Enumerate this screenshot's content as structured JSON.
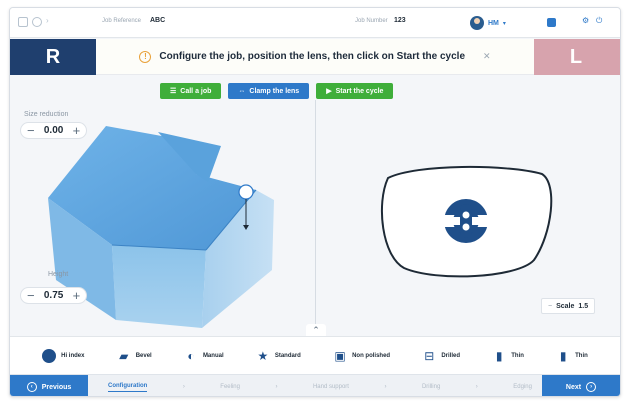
{
  "topbar": {
    "job_reference_label": "Job Reference",
    "job_reference_value": "ABC",
    "job_number_label": "Job Number",
    "job_number_value": "123",
    "user_name": "HM"
  },
  "sides": {
    "right": "R",
    "left": "L"
  },
  "banner": {
    "text": "Configure the job, position the lens, then click on Start the cycle"
  },
  "actions": [
    {
      "label": "Call a job",
      "icon": "list-icon"
    },
    {
      "label": "Clamp the lens",
      "icon": "clamp-icon"
    },
    {
      "label": "Start the cycle",
      "icon": "play-icon"
    }
  ],
  "size_reduction": {
    "label": "Size reduction",
    "value": "0.00"
  },
  "height": {
    "label": "Height",
    "value": "0.75"
  },
  "scale": {
    "label": "Scale",
    "value": "1.5"
  },
  "options": [
    {
      "label": "Hi index",
      "icon": "lens-index-icon"
    },
    {
      "label": "Bevel",
      "icon": "bevel-icon"
    },
    {
      "label": "Manual",
      "icon": "manual-icon"
    },
    {
      "label": "Standard",
      "icon": "star-icon"
    },
    {
      "label": "Non polished",
      "icon": "polish-icon"
    },
    {
      "label": "Drilled",
      "icon": "drill-icon"
    },
    {
      "label": "Thin",
      "icon": "thin-icon"
    },
    {
      "label": "Thin",
      "icon": "thin-icon-2"
    }
  ],
  "nav": {
    "previous": "Previous",
    "next": "Next",
    "steps": [
      "Configuration",
      "Feeling",
      "Hand support",
      "Drilling",
      "Edging"
    ]
  },
  "colors": {
    "primary_blue": "#2e79c9",
    "right_side": "#1f3f6e",
    "left_side": "#d7a3ad",
    "green": "#3fae3a"
  }
}
